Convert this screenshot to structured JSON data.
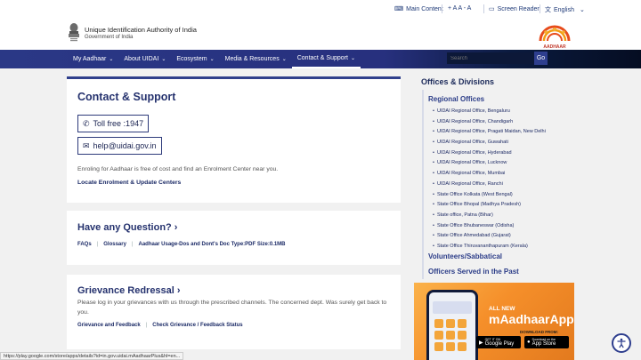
{
  "utility_bar": {
    "main_content": "Main Content",
    "text_size": "+ A A - A",
    "screen_reader": "Screen Reader",
    "language": "English"
  },
  "header": {
    "org_name": "Unique Identification Authority of India",
    "org_sub": "Government of India",
    "logo_text": "AADHAAR"
  },
  "nav": {
    "items": [
      {
        "label": "My Aadhaar"
      },
      {
        "label": "About UIDAI"
      },
      {
        "label": "Ecosystem"
      },
      {
        "label": "Media & Resources"
      },
      {
        "label": "Contact & Support"
      }
    ],
    "search_placeholder": "Search",
    "go_label": "Go"
  },
  "contact": {
    "title": "Contact & Support",
    "toll_free": "Toll free :1947",
    "email": "help@uidai.gov.in",
    "enrol_text": "Enroling for Aadhaar is free of cost and find an Enrolment Center near you.",
    "locate_link": "Locate Enrolment & Update Centers"
  },
  "question": {
    "title": "Have any Question? ›",
    "links": [
      "FAQs",
      "Glossary",
      "Aadhaar Usage-Dos and Dont's Doc Type:PDF Size:0.1MB"
    ]
  },
  "grievance": {
    "title": "Grievance Redressal ›",
    "text": "Please log in your grievances with us through the prescribed channels. The concerned dept. Was surely get back to you.",
    "links": [
      "Grievance and Feedback",
      "Check Grievance / Feedback Status"
    ]
  },
  "offices": {
    "title": "Offices & Divisions",
    "regional_heading": "Regional Offices",
    "items": [
      "UIDAI Regional Office, Bengaluru",
      "UIDAI Regional Office, Chandigarh",
      "UIDAI Regional Office, Pragati Maidan, New Delhi",
      "UIDAI Regional Office, Guwahati",
      "UIDAI Regional Office, Hyderabad",
      "UIDAI Regional Office, Lucknow",
      "UIDAI Regional Office, Mumbai",
      "UIDAI Regional Office, Ranchi",
      "State Office Kolkata (West Bengal)",
      "State Office Bhopal (Madhya Pradesh)",
      "State office, Patna (Bihar)",
      "State Office Bhubaneswar (Odisha)",
      "State Office Ahmedabad (Gujarat)",
      "State Office Thiruvananthapuram (Kerala)"
    ],
    "volunteers": "Volunteers/Sabbatical",
    "officers": "Officers Served in the Past"
  },
  "promo": {
    "all_new": "ALL NEW",
    "app_name": "mAadhaarApp",
    "download_from": "DOWNLOAD FROM:",
    "google_small": "GET IT ON",
    "google": "Google Play",
    "apple_small": "Download on the",
    "apple": "App Store"
  },
  "status_url": "https://play.google.com/store/apps/details?id=in.gov.uidai.mAadhaarPlus&hl=en..."
}
